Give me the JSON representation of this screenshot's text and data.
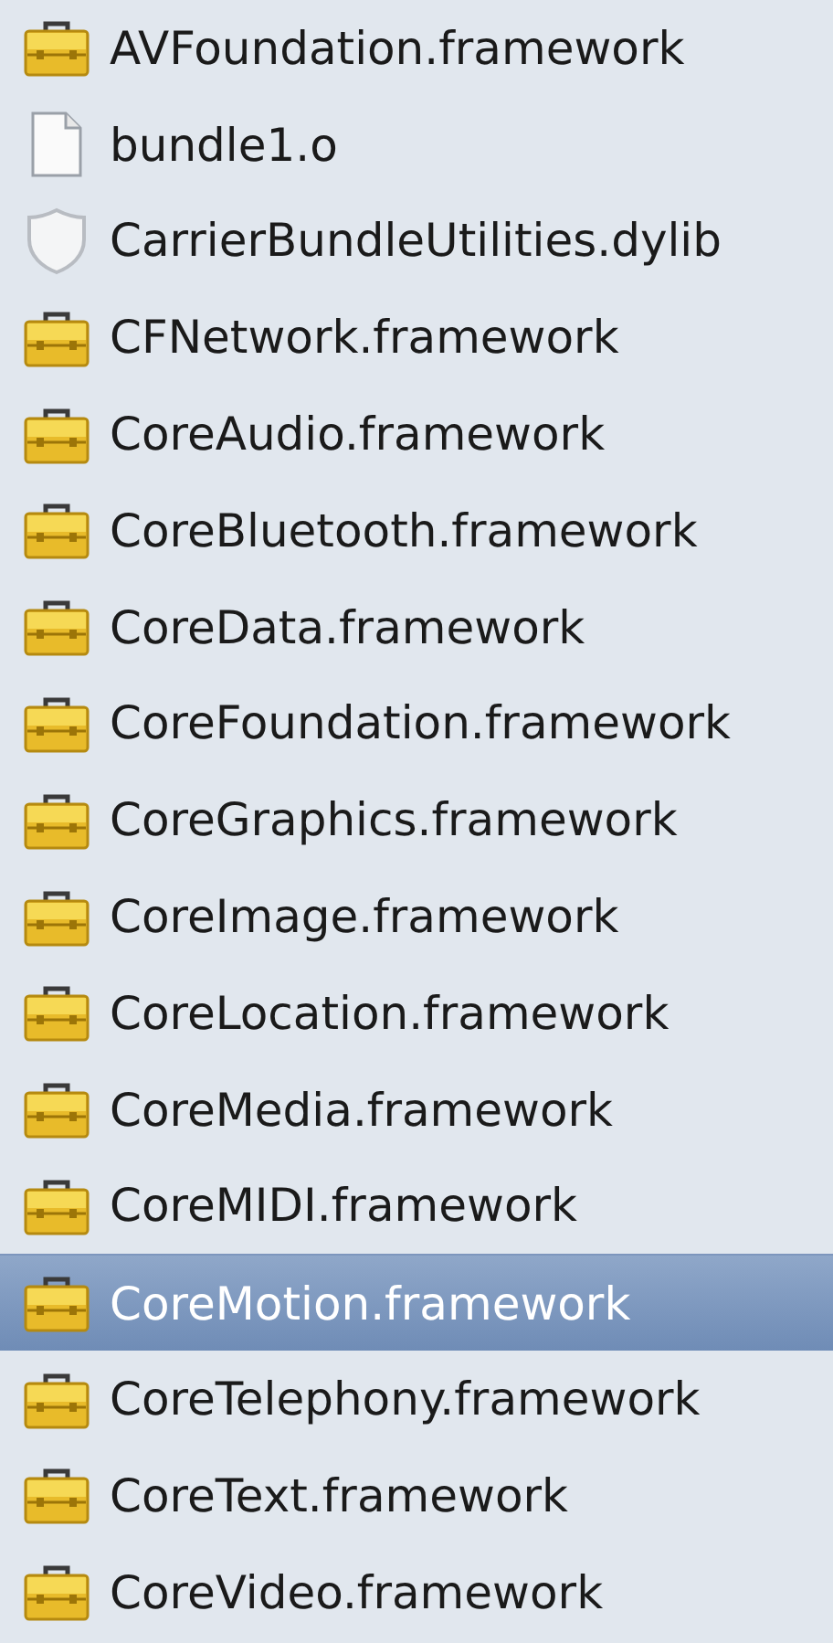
{
  "files": [
    {
      "name": "AVFoundation.framework",
      "kind": "framework",
      "selected": false
    },
    {
      "name": "bundle1.o",
      "kind": "file",
      "selected": false
    },
    {
      "name": "CarrierBundleUtilities.dylib",
      "kind": "library",
      "selected": false
    },
    {
      "name": "CFNetwork.framework",
      "kind": "framework",
      "selected": false
    },
    {
      "name": "CoreAudio.framework",
      "kind": "framework",
      "selected": false
    },
    {
      "name": "CoreBluetooth.framework",
      "kind": "framework",
      "selected": false
    },
    {
      "name": "CoreData.framework",
      "kind": "framework",
      "selected": false
    },
    {
      "name": "CoreFoundation.framework",
      "kind": "framework",
      "selected": false
    },
    {
      "name": "CoreGraphics.framework",
      "kind": "framework",
      "selected": false
    },
    {
      "name": "CoreImage.framework",
      "kind": "framework",
      "selected": false
    },
    {
      "name": "CoreLocation.framework",
      "kind": "framework",
      "selected": false
    },
    {
      "name": "CoreMedia.framework",
      "kind": "framework",
      "selected": false
    },
    {
      "name": "CoreMIDI.framework",
      "kind": "framework",
      "selected": false
    },
    {
      "name": "CoreMotion.framework",
      "kind": "framework",
      "selected": true
    },
    {
      "name": "CoreTelephony.framework",
      "kind": "framework",
      "selected": false
    },
    {
      "name": "CoreText.framework",
      "kind": "framework",
      "selected": false
    },
    {
      "name": "CoreVideo.framework",
      "kind": "framework",
      "selected": false
    }
  ]
}
